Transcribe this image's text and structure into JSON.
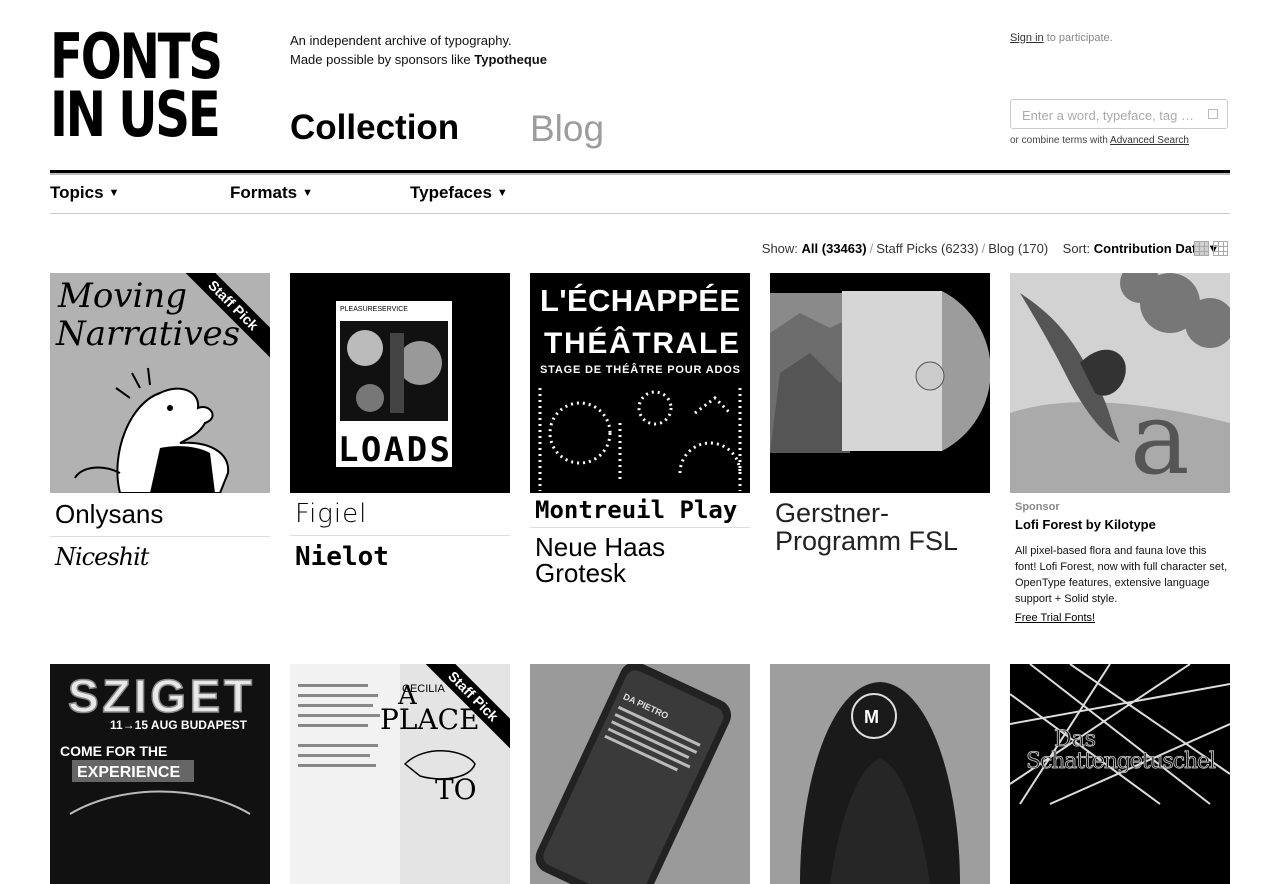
{
  "header": {
    "logo_line1": "FONTS",
    "logo_line2": "IN USE",
    "tagline_line1": "An independent archive of typography.",
    "tagline_line2_prefix": "Made possible by sponsors like ",
    "tagline_sponsor": "Typotheque",
    "section_collection": "Collection",
    "section_blog": "Blog",
    "signin_link": "Sign in",
    "signin_suffix": " to participate.",
    "search_placeholder": "Enter a word, typeface, tag …",
    "combine_prefix": "or combine terms with ",
    "advanced_search": "Advanced Search"
  },
  "nav": {
    "topics": "Topics",
    "formats": "Formats",
    "typefaces": "Typefaces",
    "caret": "▼"
  },
  "filter": {
    "show_label": "Show:",
    "all": "All (33463)",
    "staff_picks": "Staff Picks (6233)",
    "blog": "Blog (170)",
    "sort_label": "Sort:",
    "sort_value": "Contribution Date ▼"
  },
  "cards": [
    {
      "staff_pick": "Staff Pick",
      "image_alt": "Moving Narratives",
      "typefaces": [
        "Onlysans",
        "Niceshit"
      ]
    },
    {
      "image_alt": "LOADS",
      "typefaces": [
        "Figiel",
        "Nielot"
      ]
    },
    {
      "image_alt": "L'échappée théâtrale — Stage de théâtre pour ados",
      "typefaces": [
        "Montreuil Play",
        "Neue Haas Grotesk"
      ]
    },
    {
      "image_alt": "Vinyl record sleeve",
      "typefaces": [
        "Gerstner-Programm FSL"
      ]
    },
    {
      "image_alt": "Lofi Forest",
      "sponsor": true
    }
  ],
  "image_text": {
    "card1_title_l1": "Moving",
    "card1_title_l2": "Narratives",
    "card2_header": "PLEASURESERVICE",
    "card2_word": "LOADS",
    "card3_title_l1": "L'ÉCHAPPÉE",
    "card3_title_l2": "THÉÂTRALE",
    "card3_subtitle": "STAGE DE THÉÂTRE POUR ADOS",
    "sziget_title": "SZIGET",
    "sziget_dates": "11→15 AUG BUDAPEST",
    "sziget_line1": "COME FOR THE",
    "sziget_line2": "EXPERIENCE",
    "place_header": "CECILIA",
    "place_word1": "A",
    "place_word2": "PLACE",
    "place_word3": "TO",
    "phone_header": "DA PIETRO",
    "schatten_title_l1": "Das",
    "schatten_title_l2": "Schattengetuschel"
  },
  "sponsor": {
    "label": "Sponsor",
    "title": "Lofi Forest by Kilotype",
    "body": "All pixel-based flora and fauna love this font! Lofi Forest, now with full character set, OpenType features, extensive language support + Solid style.",
    "link": "Free Trial Fonts!"
  },
  "row2": [
    {
      "image_alt": "Sziget festival poster"
    },
    {
      "staff_pick": "Staff Pick",
      "image_alt": "A Place To book"
    },
    {
      "image_alt": "Da Pietro phone"
    },
    {
      "image_alt": "Hooded jacket"
    },
    {
      "image_alt": "Das Schattengetuschel"
    }
  ]
}
